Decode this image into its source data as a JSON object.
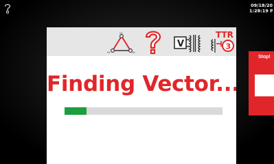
{
  "top_bar": {
    "help_icon": "question-mark-icon",
    "date": "09/18/20",
    "time": "1:28:19 P"
  },
  "panel": {
    "header_icons": [
      "vector-diagram-icon",
      "question-icon",
      "voltage-transformer-icon",
      "ttr-3phase-icon"
    ],
    "ttr_text": "TTR",
    "phase_text": "3"
  },
  "status": {
    "title": "Finding Vector...",
    "progress": 0.14
  },
  "stop": {
    "label": "Stop!"
  },
  "colors": {
    "accent_red": "#e1262a",
    "progress_green": "#1d9e3e",
    "header_gray": "#e6e6e6"
  }
}
